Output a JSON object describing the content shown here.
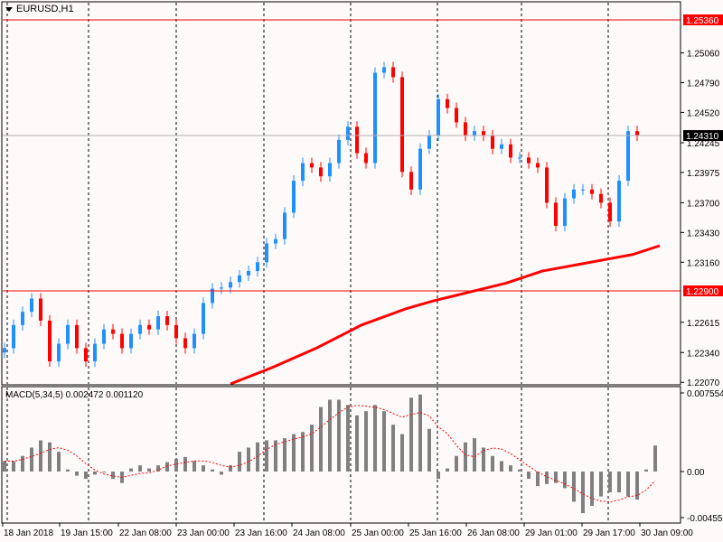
{
  "header": {
    "symbol_timeframe": "EURUSD,H1"
  },
  "macd_label": "MACD(5,34,5) 0.002472 0.001120",
  "colors": {
    "bull": "#1e90ff",
    "bear": "#ff0000",
    "ma": "#ff0000",
    "hist": "#808080",
    "signal": "#ff0000",
    "level": "#ff0000",
    "background": "#fffafa"
  },
  "chart_data": {
    "type": "candlestick",
    "title": "EURUSD,H1",
    "ylim": [
      1.2207,
      1.256
    ],
    "closes": [
      1.2238,
      1.2259,
      1.2271,
      1.2283,
      1.2263,
      1.2226,
      1.2242,
      1.2259,
      1.2238,
      1.2226,
      1.2242,
      1.2255,
      1.2251,
      1.2238,
      1.2251,
      1.2259,
      1.2255,
      1.2267,
      1.2259,
      1.2247,
      1.2238,
      1.2251,
      1.2279,
      1.2292,
      1.2293,
      1.2298,
      1.2304,
      1.2308,
      1.2316,
      1.2333,
      1.2337,
      1.2361,
      1.239,
      1.2406,
      1.2402,
      1.2394,
      1.2406,
      1.2427,
      1.2439,
      1.2415,
      1.2406,
      1.2488,
      1.2493,
      1.2484,
      1.2398,
      1.2382,
      1.2419,
      1.2431,
      1.2464,
      1.2456,
      1.2443,
      1.2431,
      1.2435,
      1.2431,
      1.2419,
      1.2423,
      1.2411,
      1.2411,
      1.2406,
      1.2402,
      1.237,
      1.2349,
      1.2374,
      1.2382,
      1.2382,
      1.2378,
      1.237,
      1.2353,
      1.239,
      1.2435,
      1.2431
    ],
    "moving_average": [
      [
        25,
        1.2205
      ],
      [
        29.5,
        1.222
      ],
      [
        34.5,
        1.2238
      ],
      [
        39.5,
        1.2259
      ],
      [
        44.5,
        1.2274
      ],
      [
        47.5,
        1.2281
      ],
      [
        51.5,
        1.2289
      ],
      [
        55.5,
        1.2297
      ],
      [
        59.5,
        1.2308
      ],
      [
        63.5,
        1.2314
      ],
      [
        67.5,
        1.232
      ],
      [
        69.5,
        1.2323
      ],
      [
        72.5,
        1.2331
      ]
    ],
    "price_ticks": [
      "1.25060",
      "1.24790",
      "1.24520",
      "1.24245",
      "1.23975",
      "1.23700",
      "1.23430",
      "1.23160",
      "1.22615",
      "1.22340",
      "1.22070"
    ],
    "levels": [
      {
        "label": "1.25360",
        "value": 1.2536
      },
      {
        "label": "1.22900",
        "value": 1.229
      }
    ],
    "current_price": {
      "label": "1.24310",
      "value": 1.2431
    },
    "time_labels": [
      "18 Jan 2018",
      "19 Jan 15:00",
      "22 Jan 08:00",
      "23 Jan 00:00",
      "23 Jan 16:00",
      "24 Jan 08:00",
      "25 Jan 00:00",
      "25 Jan 16:00",
      "26 Jan 08:00",
      "29 Jan 01:00",
      "29 Jan 17:00",
      "30 Jan 09:00"
    ],
    "macd": {
      "ylim": [
        -0.004555,
        0.007554
      ],
      "tick_labels": [
        "0.007554",
        "0.00",
        "-0.004555"
      ],
      "histogram": [
        0.001,
        0.001,
        0.0015,
        0.0023,
        0.003,
        0.0028,
        0.0019,
        0.0002,
        -0.0004,
        -0.0007,
        -0.0003,
        0.0,
        -0.0007,
        -0.0011,
        0.0003,
        0.0006,
        0.0003,
        0.0006,
        0.0009,
        0.0012,
        0.0014,
        0.001,
        0.0006,
        0.0002,
        -0.0003,
        0.0006,
        0.0019,
        0.0023,
        0.0028,
        0.003,
        0.003,
        0.0032,
        0.0036,
        0.0038,
        0.0045,
        0.0062,
        0.0069,
        0.0069,
        0.0064,
        0.0054,
        0.0058,
        0.0064,
        0.0058,
        0.0045,
        0.0036,
        0.0071,
        0.0074,
        0.0041,
        -0.0007,
        0.0003,
        0.0015,
        0.0028,
        0.0032,
        0.0023,
        0.0015,
        0.001,
        0.0006,
        0.0002,
        -0.0007,
        -0.0014,
        -0.0012,
        -0.0011,
        -0.0016,
        -0.0029,
        -0.004,
        -0.0033,
        -0.0024,
        -0.002,
        -0.002,
        -0.0024,
        -0.0027,
        0.0002,
        0.0025
      ]
    }
  }
}
